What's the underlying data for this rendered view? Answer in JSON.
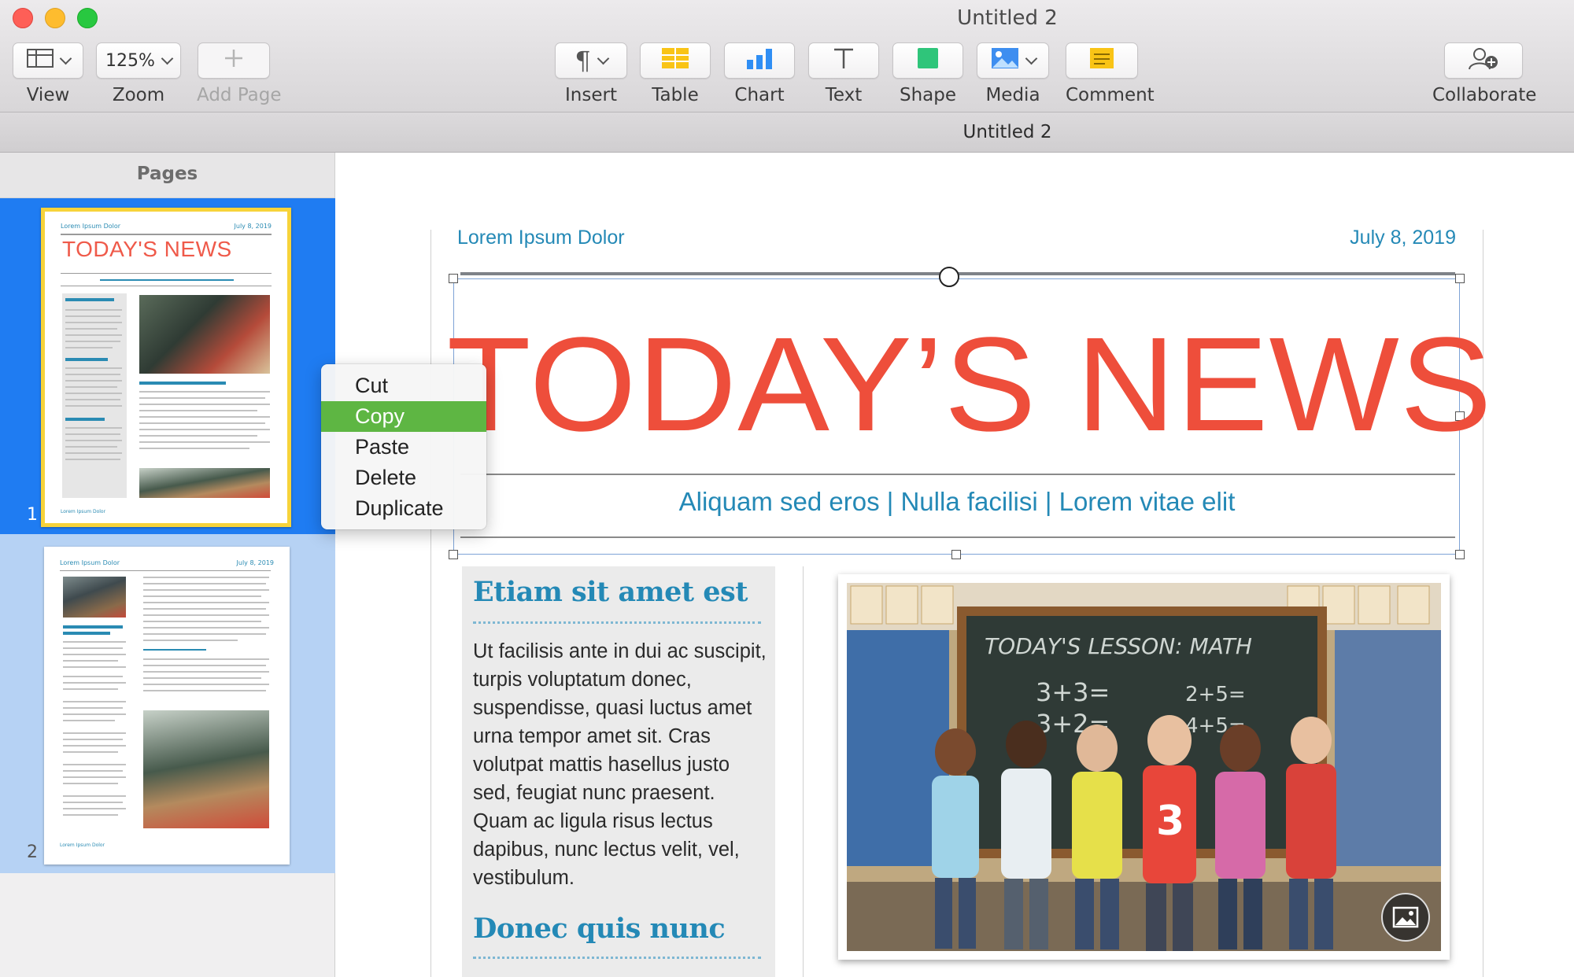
{
  "window": {
    "title": "Untitled 2"
  },
  "toolbar": {
    "view_label": "View",
    "zoom_value": "125%",
    "zoom_label": "Zoom",
    "add_page_label": "Add Page",
    "insert_label": "Insert",
    "table_label": "Table",
    "chart_label": "Chart",
    "text_label": "Text",
    "shape_label": "Shape",
    "media_label": "Media",
    "comment_label": "Comment",
    "collaborate_label": "Collaborate",
    "icons": {
      "view": "sidebar-layout-icon",
      "add_page": "plus-icon",
      "insert": "pilcrow-icon",
      "table": "table-icon",
      "chart": "bar-chart-icon",
      "text": "text-t-icon",
      "shape": "square-shape-icon",
      "media": "photo-icon",
      "comment": "comment-note-icon",
      "collaborate": "person-add-icon"
    }
  },
  "doc_tab": {
    "title": "Untitled 2"
  },
  "sidebar": {
    "header": "Pages",
    "pages": [
      {
        "number": "1",
        "selected": true
      },
      {
        "number": "2",
        "selected": false
      }
    ]
  },
  "thumbnails": {
    "page1": {
      "header_left": "Lorem Ipsum Dolor",
      "header_right": "July 8, 2019",
      "title": "TODAY'S NEWS"
    },
    "page2": {
      "header_left": "Lorem Ipsum Dolor",
      "header_right": "July 8, 2019"
    }
  },
  "context_menu": {
    "items": [
      {
        "label": "Cut",
        "active": false
      },
      {
        "label": "Copy",
        "active": true
      },
      {
        "label": "Paste",
        "active": false
      },
      {
        "label": "Delete",
        "active": false
      },
      {
        "label": "Duplicate",
        "active": false
      }
    ]
  },
  "document": {
    "header_left": "Lorem Ipsum Dolor",
    "header_right": "July 8, 2019",
    "headline": "TODAY’S NEWS",
    "subhead": "Aliquam sed eros | Nulla facilisi | Lorem vitae elit",
    "sidebar_box": {
      "heading1": "Etiam sit amet est",
      "body": "Ut facilisis ante in dui ac suscipit, turpis voluptatum donec, suspendisse, quasi luctus amet urna tempor amet sit. Cras volutpat mattis hasellus justo sed, feugiat nunc praesent. Quam ac ligula risus lectus dapibus, nunc lectus velit, vel, vestibulum.",
      "heading2": "Donec quis nunc"
    },
    "photo": {
      "description": "classroom-children-photo",
      "media_button_icon": "photo-icon"
    }
  },
  "colors": {
    "accent_blue": "#2489b6",
    "headline_red": "#ee4e3b",
    "selection_blue": "#1f7cf2",
    "menu_highlight": "#5eb643",
    "thumb_selected_border": "#f7d33a"
  }
}
